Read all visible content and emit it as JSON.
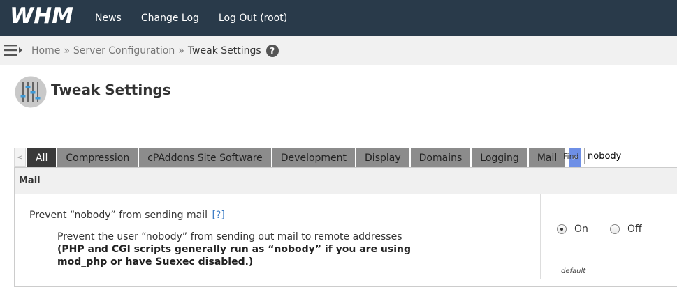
{
  "brand": {
    "logo_text": "WHM"
  },
  "topnav": {
    "items": [
      {
        "label": "News"
      },
      {
        "label": "Change Log"
      },
      {
        "label": "Log Out (root)"
      }
    ]
  },
  "breadcrumb": {
    "items": [
      {
        "label": "Home"
      },
      {
        "label": "Server Configuration"
      },
      {
        "label": "Tweak Settings"
      }
    ],
    "separator": "»"
  },
  "page": {
    "title": "Tweak Settings"
  },
  "tabs": {
    "prev": "<",
    "next": ">",
    "items": [
      {
        "label": "All",
        "active": true
      },
      {
        "label": "Compression"
      },
      {
        "label": "cPAddons Site Software"
      },
      {
        "label": "Development"
      },
      {
        "label": "Display"
      },
      {
        "label": "Domains"
      },
      {
        "label": "Logging"
      },
      {
        "label": "Mail"
      }
    ]
  },
  "find": {
    "label": "Find",
    "value": "nobody"
  },
  "panel": {
    "heading": "Mail",
    "setting": {
      "name": "Prevent “nobody” from sending mail",
      "help_link": "[?]",
      "description": "Prevent the user “nobody” from sending out mail to remote addresses",
      "note": "(PHP and CGI scripts generally run as “nobody” if you are using mod_php or have Suexec disabled.)",
      "options": [
        {
          "label": "On",
          "checked": true
        },
        {
          "label": "Off",
          "checked": false
        }
      ],
      "default_label": "default"
    }
  },
  "colors": {
    "topbar": "#293a4a",
    "active_tab": "#3a3a3a",
    "tab": "#8c8c8c",
    "next_button": "#6e8fe6",
    "link": "#3a7ac4"
  },
  "icons": {
    "menu_toggle": "hamburger-arrow-icon",
    "help": "question-circle-icon",
    "page": "sliders-icon"
  }
}
